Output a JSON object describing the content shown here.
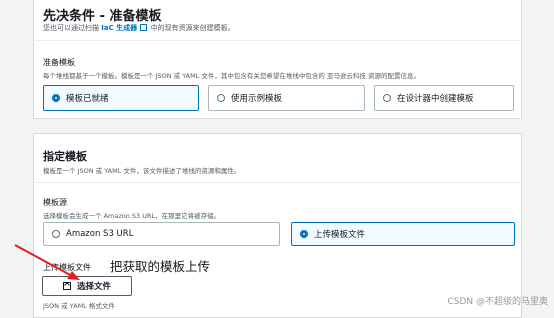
{
  "prereq": {
    "title": "先决条件 - 准备模板",
    "desc_before": "您也可以通过扫描",
    "desc_link": "IaC 生成器",
    "desc_after": "中的现有资源来创建模板。",
    "prepare_label": "准备模板",
    "prepare_desc": "每个堆栈都基于一个模板。模板是一个 JSON 或 YAML 文件，其中包含有关您希望在堆栈中包含的 亚马逊云科技 资源的配置信息。",
    "options": [
      "模板已就绪",
      "使用示例模板",
      "在设计器中创建模板"
    ],
    "selected": "模板已就绪"
  },
  "specify": {
    "title": "指定模板",
    "desc": "模板是一个 JSON 或 YAML 文件，该文件描述了堆栈的资源和属性。",
    "source_label": "模板源",
    "source_desc": "选择模板会生成一个 Amazon S3 URL，在那里它将被存储。",
    "source_options": [
      "Amazon S3 URL",
      "上传模板文件"
    ],
    "source_selected": "上传模板文件",
    "upload_label": "上传模板文件",
    "choose_file": "选择文件",
    "file_hint": "JSON 或 YAML 格式文件"
  },
  "annotation": "把获取的模板上传",
  "watermark": "CSDN @不超级的马里奥"
}
